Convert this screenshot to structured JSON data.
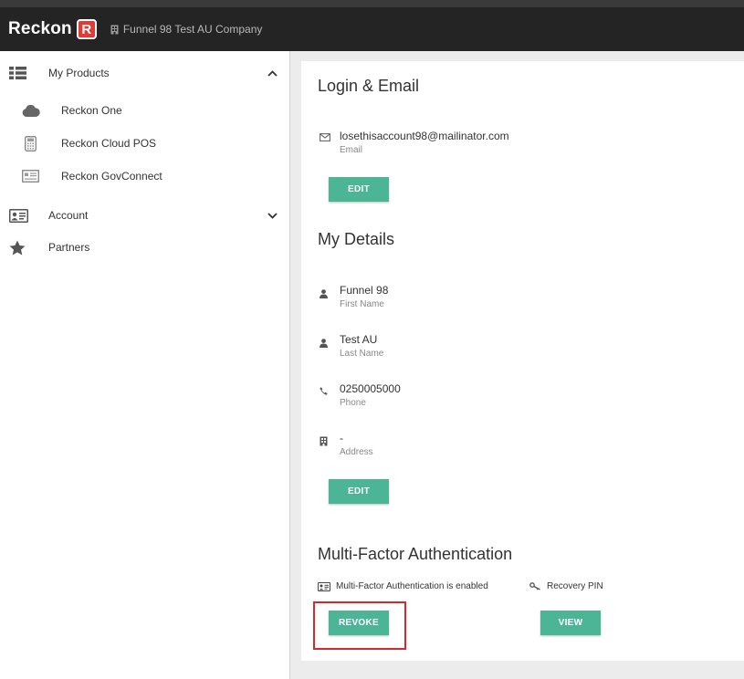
{
  "header": {
    "logo_text": "Reckon",
    "logo_mark": "R",
    "company_name": "Funnel 98 Test AU Company",
    "company_icon": "building-icon"
  },
  "sidebar": {
    "my_products": {
      "label": "My Products",
      "icon": "grid-list-icon",
      "expanded": true
    },
    "products": [
      {
        "label": "Reckon One",
        "icon": "cloud-icon"
      },
      {
        "label": "Reckon Cloud POS",
        "icon": "pos-terminal-icon"
      },
      {
        "label": "Reckon GovConnect",
        "icon": "govconnect-icon"
      }
    ],
    "account": {
      "label": "Account",
      "icon": "id-card-icon",
      "expanded": false
    },
    "partners": {
      "label": "Partners",
      "icon": "star-icon"
    }
  },
  "login_email": {
    "title": "Login & Email",
    "email_value": "losethisaccount98@mailinator.com",
    "email_label": "Email",
    "edit_label": "EDIT"
  },
  "my_details": {
    "title": "My Details",
    "first_name_value": "Funnel 98",
    "first_name_label": "First Name",
    "last_name_value": "Test AU",
    "last_name_label": "Last Name",
    "phone_value": "0250005000",
    "phone_label": "Phone",
    "address_value": "-",
    "address_label": "Address",
    "edit_label": "EDIT"
  },
  "mfa": {
    "title": "Multi-Factor Authentication",
    "status_text": "Multi-Factor Authentication is enabled",
    "recovery_label": "Recovery PIN",
    "revoke_label": "REVOKE",
    "view_label": "VIEW"
  },
  "colors": {
    "accent": "#4cb596",
    "brand_red": "#e53935",
    "header_bg": "#242424",
    "highlight": "#d9272e"
  }
}
